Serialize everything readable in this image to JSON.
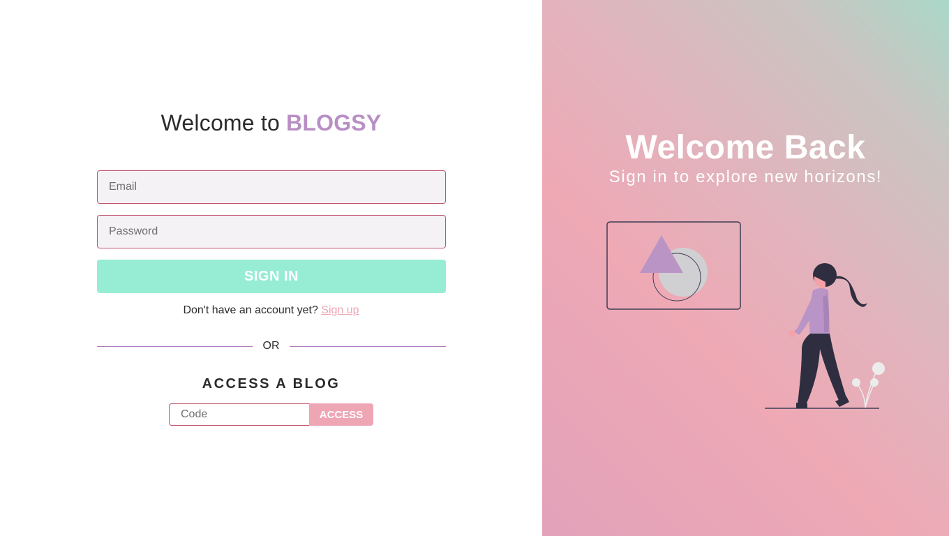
{
  "login": {
    "title_prefix": "Welcome to",
    "brand_name": "BLOGSY",
    "email_placeholder": "Email",
    "password_placeholder": "Password",
    "signin_label": "SIGN IN",
    "no_account_text": "Don't have an account yet?",
    "signup_link": "Sign up",
    "or_text": "OR",
    "access_title": "ACCESS A BLOG",
    "code_placeholder": "Code",
    "access_label": "ACCESS"
  },
  "hero": {
    "title": "Welcome Back",
    "subtitle": "Sign in to explore new horizons!"
  },
  "illustration": {
    "name": "woman-looking-at-picture-illustration"
  },
  "colors": {
    "brand": "#b88fc4",
    "signin_button": "#96edd4",
    "accent_pink": "#eea5b4",
    "input_border": "#c1536d",
    "divider": "#b17bbf"
  }
}
